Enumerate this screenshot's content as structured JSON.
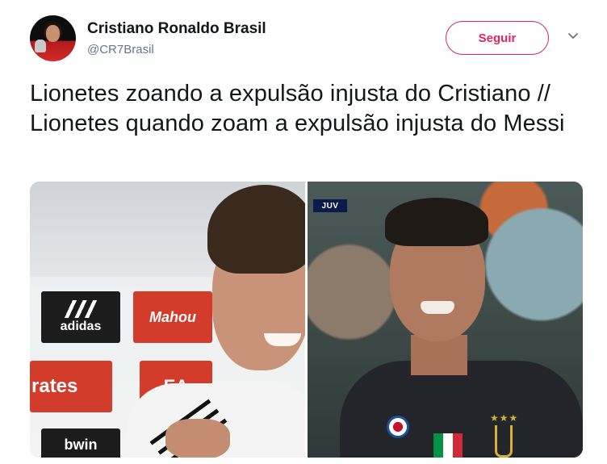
{
  "tweet": {
    "author_name": "Cristiano Ronaldo Brasil",
    "handle": "@CR7Brasil",
    "follow_label": "Seguir",
    "text": "Lionetes zoando a expulsão injusta do Cristiano // Lionetes quando zoam a expulsão injusta do Messi"
  },
  "media": {
    "left_image": {
      "sponsor_labels": [
        "adidas",
        "Mahou",
        "rates",
        "EA",
        "bwin"
      ]
    },
    "right_image": {
      "scoreboard_badge": "JUV"
    }
  },
  "colors": {
    "follow_accent": "#e0245e",
    "handle_gray": "#657786",
    "text": "#14171a"
  },
  "icons": {
    "caret": "chevron-down-icon"
  }
}
